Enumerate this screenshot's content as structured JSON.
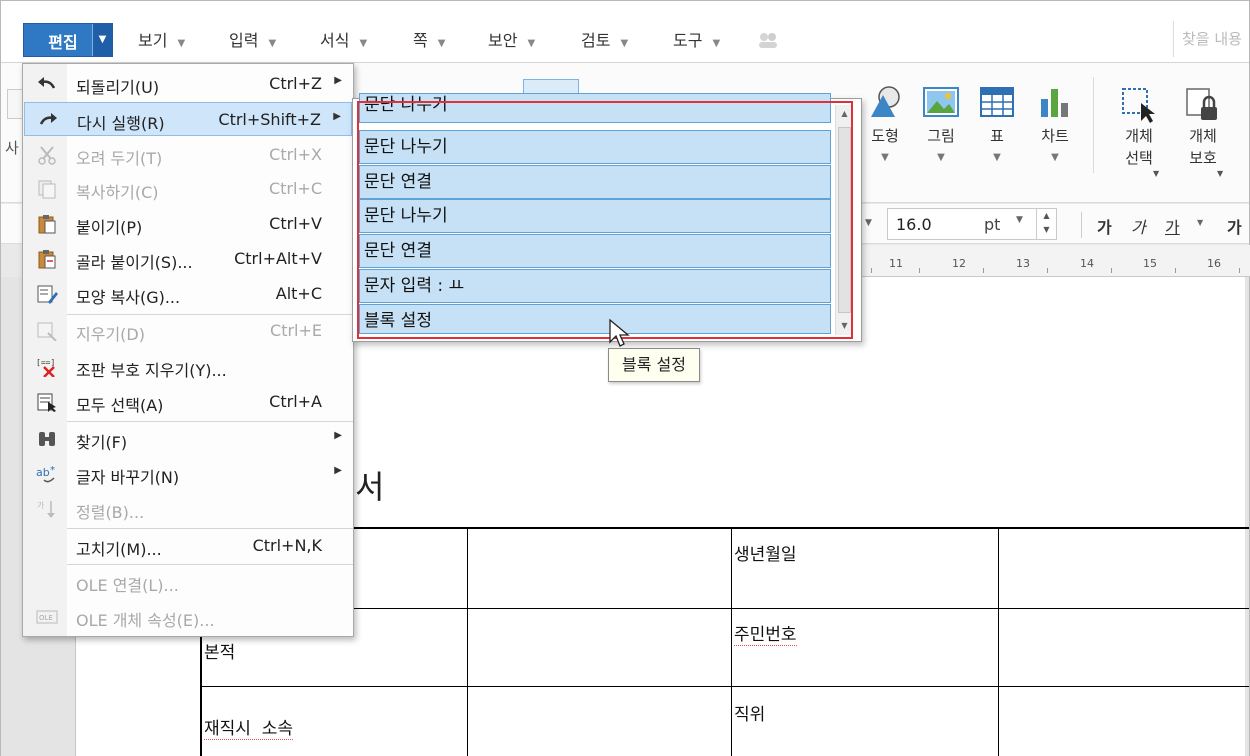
{
  "menubar": {
    "active_tab": "편집",
    "tabs": [
      {
        "label": "보기"
      },
      {
        "label": "입력"
      },
      {
        "label": "서식"
      },
      {
        "label": "쪽"
      },
      {
        "label": "보안"
      },
      {
        "label": "검토"
      },
      {
        "label": "도구"
      }
    ],
    "search_placeholder": "찾을 내용"
  },
  "ribbon": {
    "items": [
      {
        "label": "도형"
      },
      {
        "label": "그림"
      },
      {
        "label": "표"
      },
      {
        "label": "차트"
      },
      {
        "label": "개체\n선택"
      },
      {
        "label": "개체\n보호"
      }
    ],
    "partial_left_label": "사"
  },
  "format_bar": {
    "font_size": "16.0",
    "unit": "pt",
    "style_buttons": [
      "가",
      "가",
      "가",
      "가"
    ]
  },
  "ruler": {
    "ticks": [
      "11",
      "12",
      "13",
      "14",
      "15",
      "16"
    ]
  },
  "edit_menu": {
    "items": [
      {
        "label": "되돌리기(U)",
        "shortcut": "Ctrl+Z",
        "submenu": true,
        "disabled": false,
        "icon": "undo-icon"
      },
      {
        "label": "다시 실행(R)",
        "shortcut": "Ctrl+Shift+Z",
        "submenu": true,
        "disabled": false,
        "icon": "redo-icon",
        "highlighted": true
      },
      {
        "label": "오려 두기(T)",
        "shortcut": "Ctrl+X",
        "disabled": true,
        "icon": "cut-icon"
      },
      {
        "label": "복사하기(C)",
        "shortcut": "Ctrl+C",
        "disabled": true,
        "icon": "copy-icon"
      },
      {
        "label": "붙이기(P)",
        "shortcut": "Ctrl+V",
        "disabled": false,
        "icon": "paste-icon"
      },
      {
        "label": "골라 붙이기(S)...",
        "shortcut": "Ctrl+Alt+V",
        "disabled": false,
        "icon": "paste-special-icon"
      },
      {
        "label": "모양 복사(G)...",
        "shortcut": "Alt+C",
        "disabled": false,
        "icon": "format-painter-icon"
      },
      {
        "label": "지우기(D)",
        "shortcut": "Ctrl+E",
        "disabled": true,
        "icon": "erase-icon"
      },
      {
        "label": "조판 부호 지우기(Y)...",
        "shortcut": "",
        "disabled": false,
        "icon": "remove-codes-icon"
      },
      {
        "label": "모두 선택(A)",
        "shortcut": "Ctrl+A",
        "disabled": false,
        "icon": "select-all-icon"
      },
      {
        "label": "찾기(F)",
        "shortcut": "",
        "submenu": true,
        "disabled": false,
        "icon": "binoculars-icon"
      },
      {
        "label": "글자 바꾸기(N)",
        "shortcut": "",
        "submenu": true,
        "disabled": false,
        "icon": "replace-text-icon"
      },
      {
        "label": "정렬(B)...",
        "shortcut": "",
        "disabled": true,
        "icon": "sort-icon"
      },
      {
        "label": "고치기(M)...",
        "shortcut": "Ctrl+N,K",
        "disabled": false,
        "icon": ""
      },
      {
        "label": "OLE 연결(L)...",
        "shortcut": "",
        "disabled": true,
        "icon": ""
      },
      {
        "label": "OLE 개체 속성(E)...",
        "shortcut": "",
        "disabled": true,
        "icon": "ole-icon"
      }
    ]
  },
  "redo_list": {
    "items": [
      "문단 나누기",
      "문단 나누기",
      "문단 연결",
      "문단 나누기",
      "문단 연결",
      "문자 입력 : ㅛ",
      "블록 설정"
    ]
  },
  "tooltip": "블록 설정",
  "document": {
    "title_partial": "서",
    "cells": {
      "birth_date": "생년월일",
      "resident_number": "주민번호",
      "hometown": "본적",
      "affiliation": "재직시  소속",
      "position": "직위"
    }
  },
  "colors": {
    "accent": "#2f78c4",
    "highlight": "#c6e1f5",
    "annotation": "#e0303a"
  }
}
